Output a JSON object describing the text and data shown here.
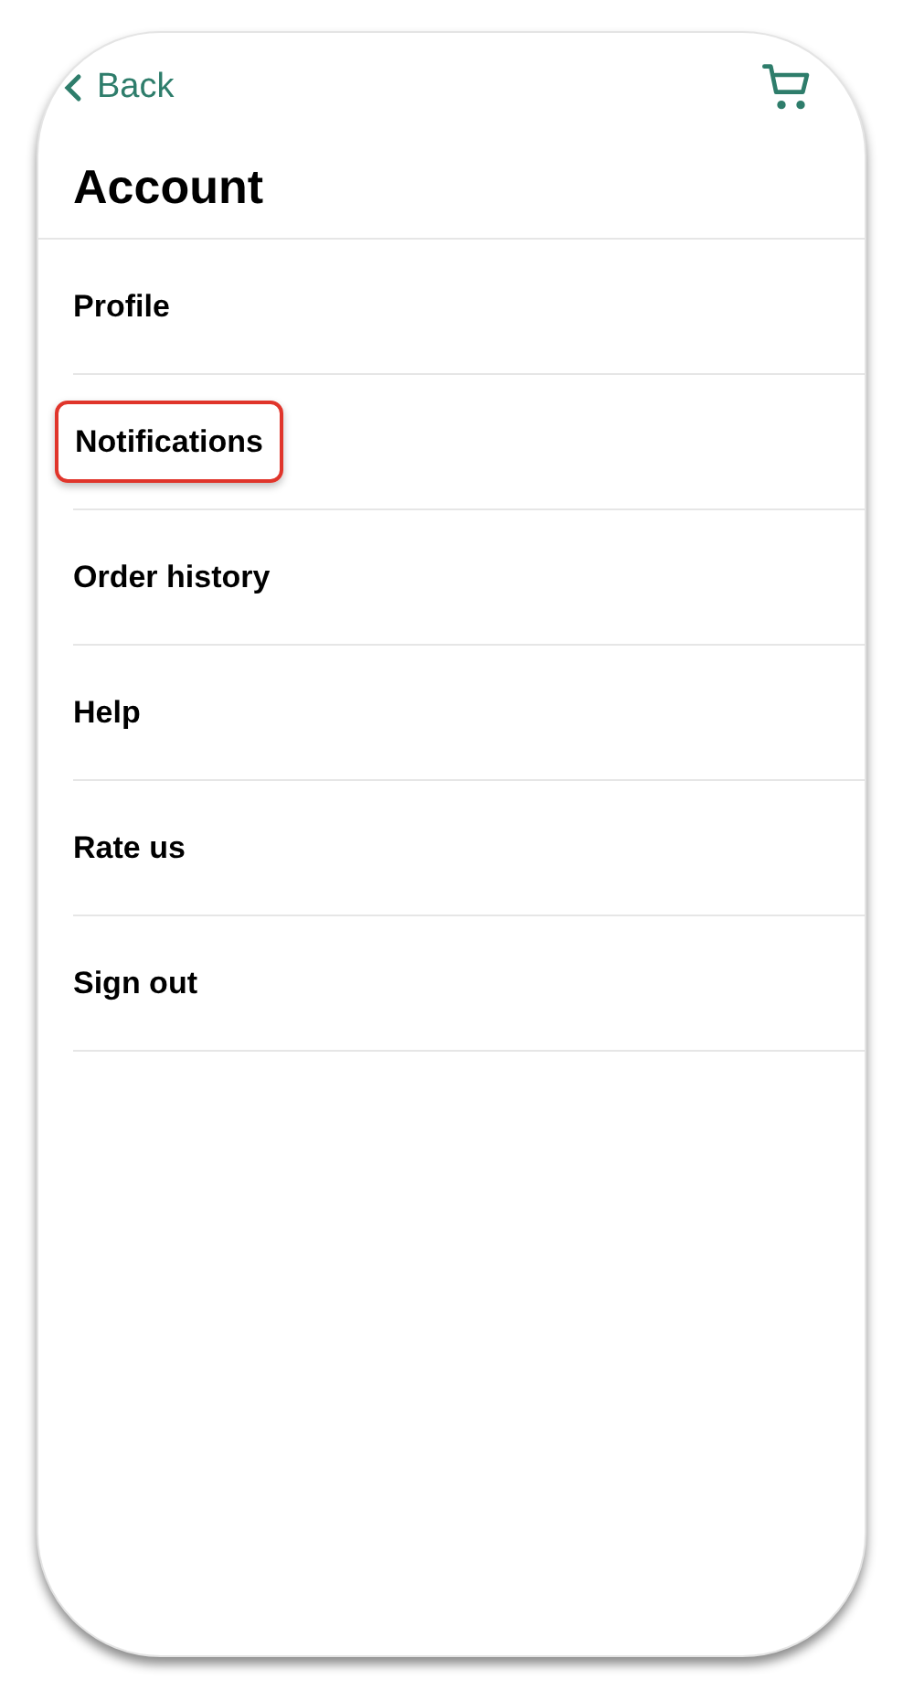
{
  "nav": {
    "back": "Back"
  },
  "title": "Account",
  "items": [
    {
      "label": "Profile",
      "highlighted": false
    },
    {
      "label": "Notifications",
      "highlighted": true
    },
    {
      "label": "Order history",
      "highlighted": false
    },
    {
      "label": "Help",
      "highlighted": false
    },
    {
      "label": "Rate us",
      "highlighted": false
    },
    {
      "label": "Sign out",
      "highlighted": false
    }
  ]
}
